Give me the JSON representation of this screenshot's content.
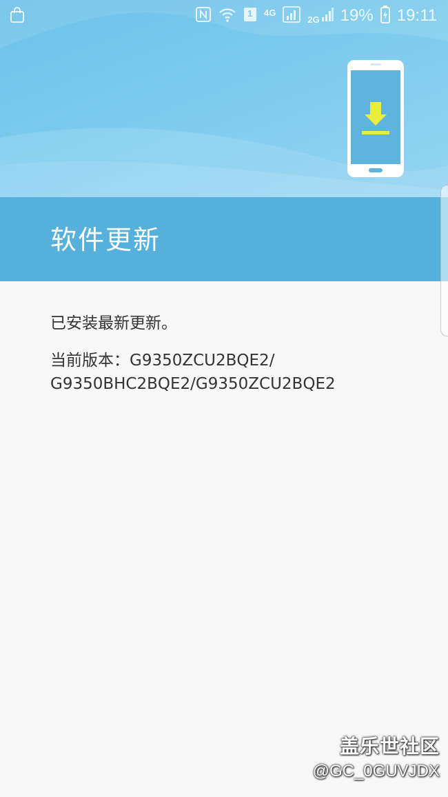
{
  "status_bar": {
    "network_type": "4G",
    "sim_badge": "1",
    "secondary_network": "2G",
    "battery": "19%",
    "time": "19:11",
    "icons": [
      "shopping-bag-icon",
      "nfc-icon",
      "wifi-icon",
      "sim-icon",
      "signal-icon",
      "battery-icon"
    ]
  },
  "header": {
    "illustration": "phone-download-icon",
    "title": "软件更新"
  },
  "content": {
    "status_message": "已安装最新更新。",
    "version_line_1": "当前版本：G9350ZCU2BQE2/",
    "version_line_2": "G9350BHC2BQE2/G9350ZCU2BQE2"
  },
  "watermark": {
    "site": "盖乐世社区",
    "user": "@GC_0GUVJDX"
  },
  "colors": {
    "banner": "#7ccbee",
    "title_band": "#55b1dc",
    "download_arrow": "#e9ee3c",
    "background": "#f8f8f8",
    "text": "#333333"
  }
}
